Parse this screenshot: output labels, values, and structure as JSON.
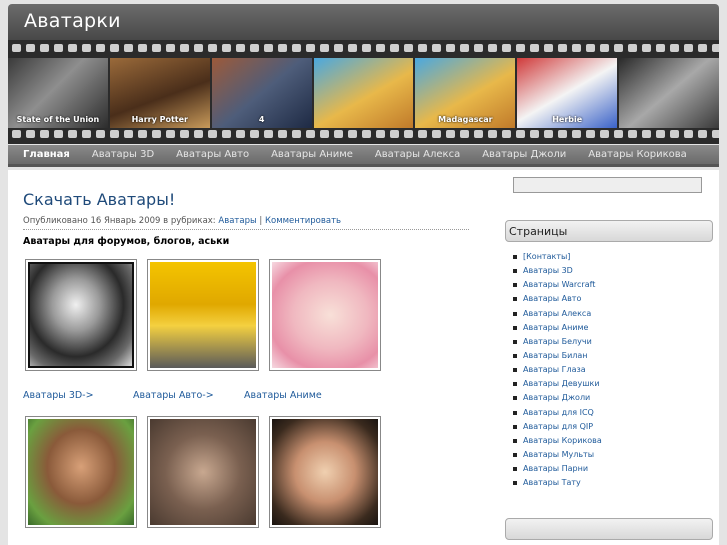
{
  "site": {
    "title": "Аватарки"
  },
  "banner": {
    "frames": [
      "State of the Union",
      "Harry Potter",
      "4",
      "",
      "Madagascar",
      "Herbie",
      ""
    ]
  },
  "nav": {
    "items": [
      {
        "label": "Главная",
        "active": true
      },
      {
        "label": "Аватары 3D"
      },
      {
        "label": "Аватары Авто"
      },
      {
        "label": "Аватары Аниме"
      },
      {
        "label": "Аватары Алекса"
      },
      {
        "label": "Аватары Джоли"
      },
      {
        "label": "Аватары Корикова"
      }
    ]
  },
  "post": {
    "title": "Скачать Аватары!",
    "meta_prefix": "Опубликовано 16 Январь 2009 в рубриках:",
    "category": "Аватары",
    "separator": "|",
    "comment_link": "Комментировать",
    "heading": "Аватары для форумов, блогов, аськи",
    "thumb_links": [
      "Аватары 3D->",
      "Аватары Авто->",
      "Аватары Аниме"
    ]
  },
  "sidebar": {
    "pages_title": "Страницы",
    "pages": [
      "[Контакты]",
      "Аватары 3D",
      "Аватары Warcraft",
      "Аватары Авто",
      "Аватары Алекса",
      "Аватары Аниме",
      "Аватары Белучи",
      "Аватары Билан",
      "Аватары Глаза",
      "Аватары Девушки",
      "Аватары Джоли",
      "Аватары для ICQ",
      "Аватары для QIP",
      "Аватары Корикова",
      "Аватары Мульты",
      "Аватары Парни",
      "Аватары Тату"
    ]
  }
}
